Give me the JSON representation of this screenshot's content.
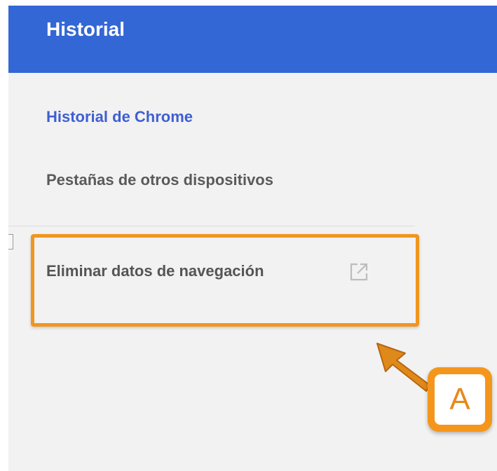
{
  "header": {
    "title": "Historial"
  },
  "nav": {
    "items": [
      {
        "label": "Historial de Chrome",
        "active": true
      },
      {
        "label": "Pestañas de otros dispositivos",
        "active": false
      }
    ]
  },
  "actions": {
    "clear_browsing_data": {
      "label": "Eliminar datos de navegación",
      "icon": "external-link-icon"
    }
  },
  "annotation": {
    "label": "A",
    "color": "#f0961f"
  },
  "colors": {
    "header_bg": "#3367d6",
    "active_link": "#3f5fd3",
    "panel_bg": "#f2f2f2"
  }
}
